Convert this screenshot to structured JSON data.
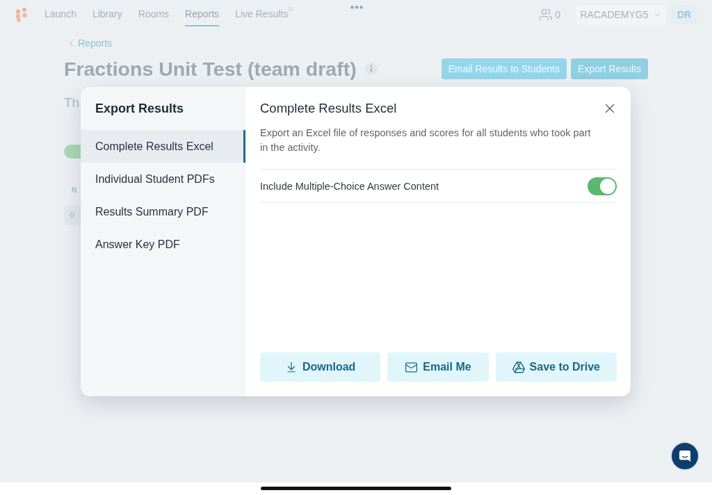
{
  "nav": {
    "tabs": [
      {
        "label": "Launch",
        "selected": false
      },
      {
        "label": "Library",
        "selected": false
      },
      {
        "label": "Rooms",
        "selected": false
      },
      {
        "label": "Reports",
        "selected": true
      },
      {
        "label": "Live Results",
        "selected": false
      }
    ],
    "student_count": "0",
    "room_selector": "RACADEMYG5",
    "avatar_initials": "DR"
  },
  "report": {
    "back_link": "Reports",
    "title": "Fractions Unit Test (team draft)",
    "actions": [
      "Email Results to Students",
      "Export Results"
    ],
    "subtitle": "Th",
    "toggle": {
      "on": true
    },
    "table_header": "N",
    "table_cell": "0"
  },
  "dialog": {
    "title": "Export Results",
    "options": [
      {
        "label": "Complete Results Excel",
        "selected": true
      },
      {
        "label": "Individual Student PDFs",
        "selected": false
      },
      {
        "label": "Results Summary PDF",
        "selected": false
      },
      {
        "label": "Answer Key PDF",
        "selected": false
      }
    ],
    "heading": "Complete Results Excel",
    "description": "Export an Excel file of responses and scores for all students who took part in the activity.",
    "settings": [
      {
        "label": "Include Multiple-Choice Answer Content",
        "on": true
      }
    ],
    "buttons": [
      {
        "label": "Download",
        "kind": "download"
      },
      {
        "label": "Email Me",
        "kind": "email"
      },
      {
        "label": "Save to Drive",
        "kind": "drive"
      }
    ]
  }
}
